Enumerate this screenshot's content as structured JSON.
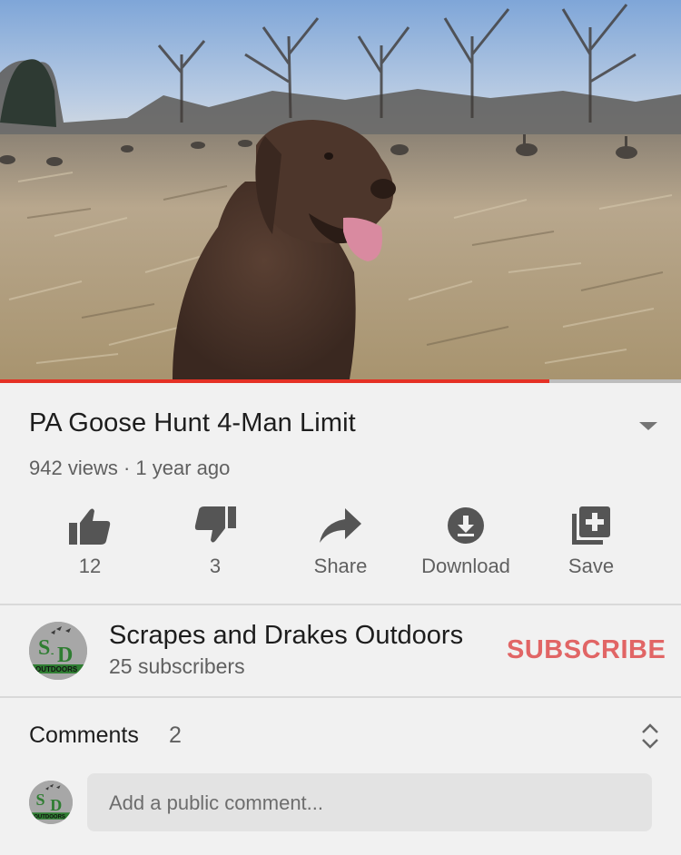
{
  "video": {
    "progress_fraction": 0.807
  },
  "title": "PA Goose Hunt 4-Man Limit",
  "meta": "942 views · 1 year ago",
  "actions": [
    {
      "icon": "thumbs-up-icon",
      "label": "12"
    },
    {
      "icon": "thumbs-down-icon",
      "label": "3"
    },
    {
      "icon": "share-icon",
      "label": "Share"
    },
    {
      "icon": "download-icon",
      "label": "Download"
    },
    {
      "icon": "playlist-add-icon",
      "label": "Save"
    }
  ],
  "channel": {
    "name": "Scrapes and Drakes Outdoors",
    "subscribers": "25 subscribers",
    "subscribe_label": "SUBSCRIBE",
    "avatar_logo_text": "S D OUTDOORS"
  },
  "comments": {
    "label": "Comments",
    "count": "2",
    "placeholder": "Add a public comment..."
  },
  "colors": {
    "progress": "#e53125",
    "subscribe": "#e16565",
    "logo_green": "#2f7d32"
  }
}
